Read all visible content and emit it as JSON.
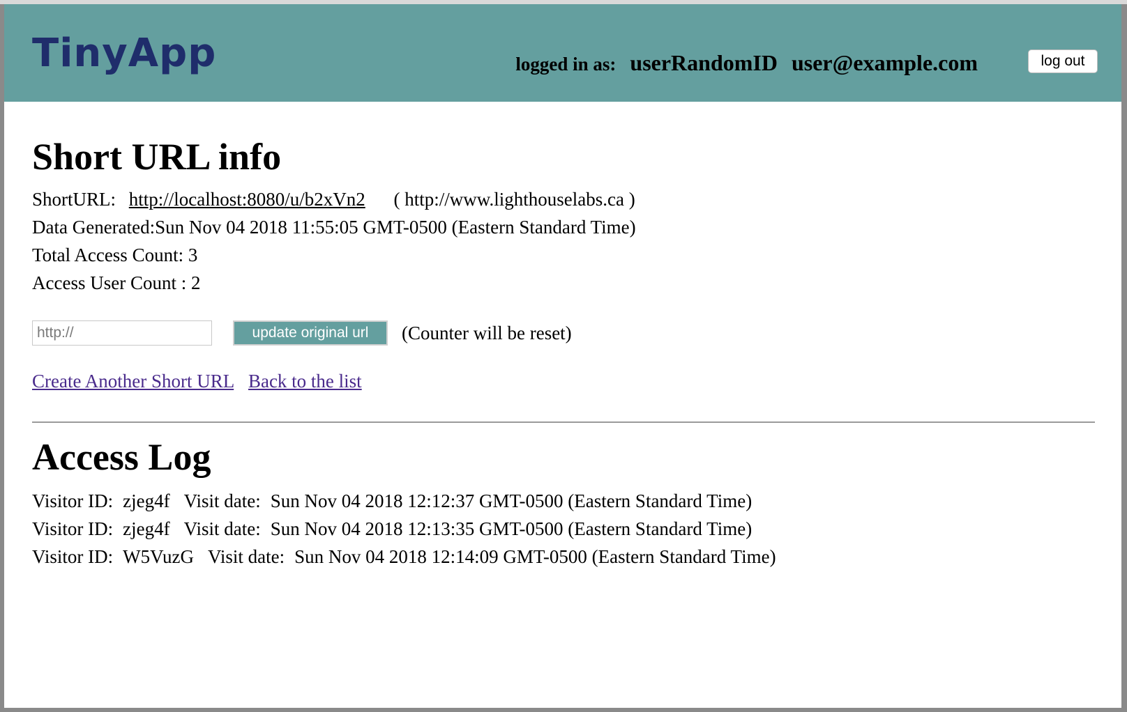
{
  "header": {
    "logo": "TinyApp",
    "logged_in_label": "logged in as:",
    "user_id": "userRandomID",
    "user_email": "user@example.com",
    "logout_label": "log out",
    "bg_color": "#649f9f",
    "logo_color": "#1f2d6b"
  },
  "info": {
    "title": "Short URL info",
    "short_url_label": "ShortURL:",
    "short_url": "http://localhost:8080/u/b2xVn2",
    "original_url": "( http://www.lighthouselabs.ca )",
    "date_generated": "Data Generated:Sun Nov 04 2018 11:55:05 GMT-0500 (Eastern Standard Time)",
    "total_access": "Total Access Count: 3",
    "user_count": "Access User Count : 2"
  },
  "form": {
    "input_placeholder": "http://",
    "update_label": "update original url",
    "note": "(Counter will be reset)"
  },
  "links": {
    "create": "Create Another Short URL",
    "back": "Back to the list"
  },
  "log": {
    "title": "Access Log",
    "visitor_label": "Visitor ID:",
    "date_label": "Visit date:",
    "entries": [
      {
        "visitor": "zjeg4f",
        "date": "Sun Nov 04 2018 12:12:37 GMT-0500 (Eastern Standard Time)"
      },
      {
        "visitor": "zjeg4f",
        "date": "Sun Nov 04 2018 12:13:35 GMT-0500 (Eastern Standard Time)"
      },
      {
        "visitor": "W5VuzG",
        "date": "Sun Nov 04 2018 12:14:09 GMT-0500 (Eastern Standard Time)"
      }
    ]
  }
}
